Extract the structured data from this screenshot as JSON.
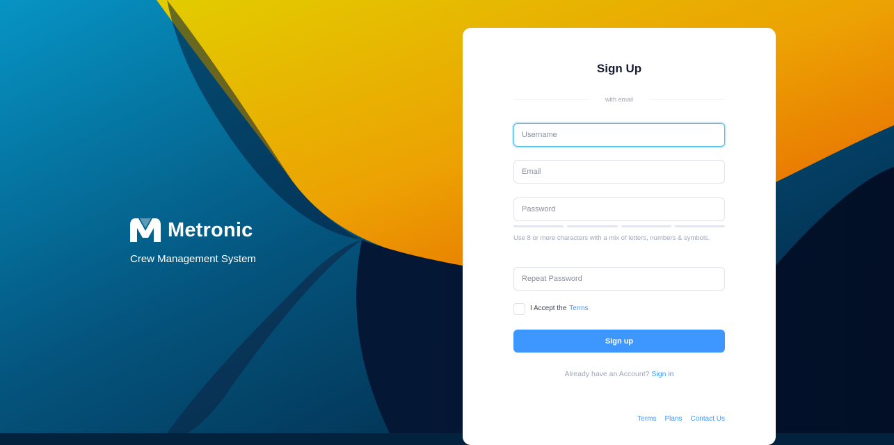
{
  "brand": {
    "name": "Metronic",
    "tagline": "Crew Management System"
  },
  "form": {
    "title": "Sign Up",
    "separator": "with email",
    "username_placeholder": "Username",
    "email_placeholder": "Email",
    "password_placeholder": "Password",
    "password_hint": "Use 8 or more characters with a mix of letters, numbers & symbols.",
    "repeat_password_placeholder": "Repeat Password",
    "accept_text": "I Accept the",
    "terms_link": "Terms",
    "submit_label": "Sign up",
    "account_text": "Already have an Account?",
    "signin_link": "Sign in"
  },
  "footer": {
    "links": [
      "Terms",
      "Plans",
      "Contact Us"
    ]
  },
  "colors": {
    "accent": "#3e97ff",
    "background_blue": "#03223d",
    "background_orange": "#f29a00"
  }
}
